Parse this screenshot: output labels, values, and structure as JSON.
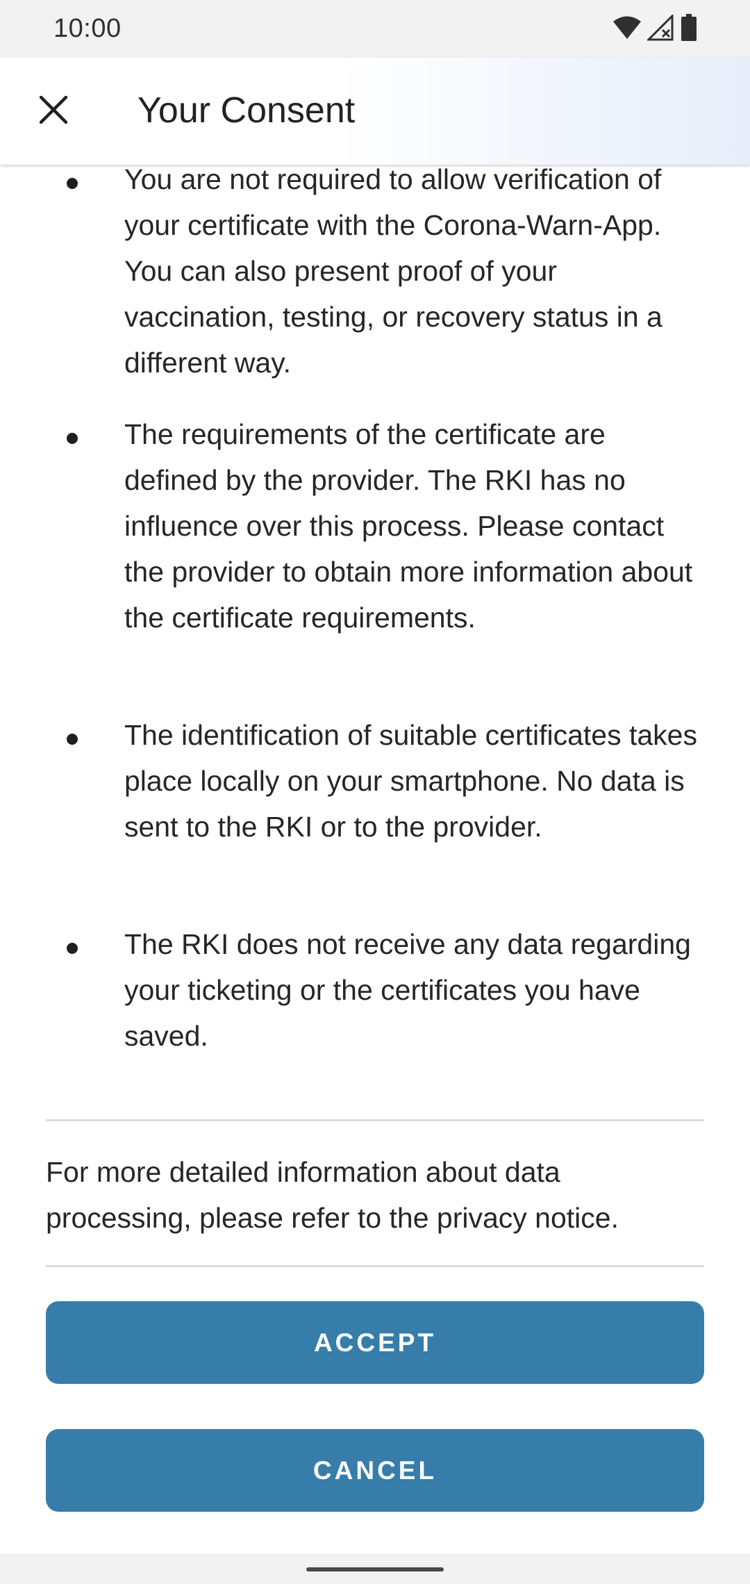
{
  "status_bar": {
    "time": "10:00",
    "icons": [
      "wifi-icon",
      "cellular-signal-off-icon",
      "battery-icon"
    ]
  },
  "app_bar": {
    "close_icon": "close-icon",
    "title": "Your Consent"
  },
  "consent": {
    "bullets": [
      "You are not required to allow verification of your certificate with the Corona-Warn-App. You can also present proof of your vaccination, testing, or recovery status in a different way.",
      "The requirements of the certificate are defined by the provider. The RKI has no influence over this process. Please contact the provider to obtain more information about the certificate requirements.",
      "The identification of suitable certificates takes place locally on your smartphone. No data is sent to the RKI or to the provider.",
      "The RKI does not receive any data regarding your ticketing or the certificates you have saved."
    ],
    "privacy_notice": "For more detailed information about data processing, please refer to the privacy notice."
  },
  "actions": {
    "accept_label": "ACCEPT",
    "cancel_label": "CANCEL"
  },
  "colors": {
    "button_background": "#377daa",
    "button_text": "#ffffff",
    "status_bar_background": "#f2f2f2"
  }
}
